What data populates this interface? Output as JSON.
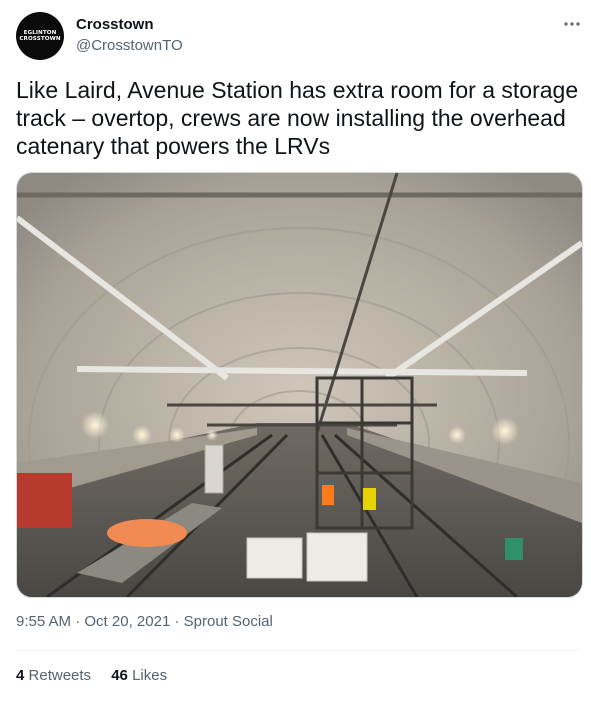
{
  "author": {
    "avatar_text_line1": "EGLINTON",
    "avatar_text_line2": "CROSSTOWN",
    "display_name": "Crosstown",
    "handle": "@CrosstownTO"
  },
  "tweet": {
    "text": "Like Laird, Avenue Station has extra room for a storage track – overtop, crews are now installing the overhead catenary that powers the LRVs",
    "media": {
      "alt": ""
    }
  },
  "meta": {
    "time": "9:55 AM",
    "date": "Oct 20, 2021",
    "separator": "·",
    "source": "Sprout Social"
  },
  "stats": {
    "retweets_count": "4",
    "retweets_label": "Retweets",
    "likes_count": "46",
    "likes_label": "Likes"
  },
  "colors": {
    "text_primary": "#0f1419",
    "text_secondary": "#536471",
    "border": "#cfd9de",
    "divider": "#eff3f4"
  },
  "icons": {
    "more": "more-horizontal-icon"
  }
}
